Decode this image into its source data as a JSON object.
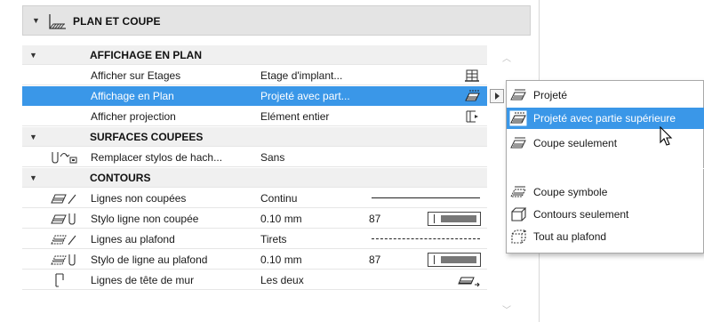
{
  "section": {
    "title": "PLAN ET COUPE",
    "icon": "plan-section-icon"
  },
  "groups": {
    "affichage": {
      "title": "AFFICHAGE EN PLAN"
    },
    "surfaces": {
      "title": "SURFACES COUPEES"
    },
    "contours": {
      "title": "CONTOURS"
    }
  },
  "rows": {
    "afficher_etages": {
      "label": "Afficher sur Etages",
      "value": "Etage d'implant...",
      "icon": "floor-stack-icon"
    },
    "affichage_plan": {
      "label": "Affichage en Plan",
      "value": "Projeté avec part...",
      "icon": "projected-overhead-icon"
    },
    "afficher_projection": {
      "label": "Afficher projection",
      "value": "Elément entier",
      "icon": "entire-element-icon"
    },
    "remplacer_stylos": {
      "label": "Remplacer stylos de hach...",
      "value": "Sans",
      "icon": "hatch-pen-override-icon"
    },
    "lignes_non_coupees": {
      "label": "Lignes non coupées",
      "value": "Continu",
      "icon": "uncut-lines-icon"
    },
    "stylo_non_coupee": {
      "label": "Stylo ligne non coupée",
      "value": "0.10 mm",
      "pen": "87",
      "icon": "uncut-pen-icon"
    },
    "lignes_plafond": {
      "label": "Lignes au plafond",
      "value": "Tirets",
      "icon": "overhead-lines-icon"
    },
    "stylo_plafond": {
      "label": "Stylo de ligne au plafond",
      "value": "0.10 mm",
      "pen": "87",
      "icon": "overhead-pen-icon"
    },
    "lignes_tete_mur": {
      "label": "Lignes de tête de mur",
      "value": "Les deux",
      "icon": "wall-end-lines-icon"
    }
  },
  "popup": {
    "items": [
      {
        "label": "Projeté",
        "icon": "projected-icon"
      },
      {
        "label": "Projeté avec partie supérieure",
        "icon": "projected-overhead-icon",
        "highlighted": true
      },
      {
        "label": "Coupe seulement",
        "icon": "cut-only-icon"
      },
      {
        "label": "Coupe symbole",
        "icon": "symbolic-cut-icon"
      },
      {
        "label": "Contours seulement",
        "icon": "outlines-only-icon"
      },
      {
        "label": "Tout au plafond",
        "icon": "overhead-all-icon"
      }
    ]
  },
  "colors": {
    "selection": "#3a97e8",
    "group_bg": "#f0f0f0",
    "header_bg": "#e4e4e4"
  }
}
